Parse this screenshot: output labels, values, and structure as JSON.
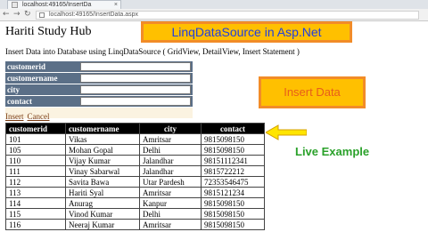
{
  "browser": {
    "tab_title": "localhost:49165/InsertDa",
    "tab_close": "×",
    "back": "←",
    "forward": "→",
    "refresh": "↻",
    "url": "localhost:49165/InsertData.aspx"
  },
  "page": {
    "site_title": "Hariti Study Hub",
    "subtitle": "Insert Data into Database using LinqDataSource ( GridView, DetailView, Insert Statement )"
  },
  "overlays": {
    "banner": "LinqDataSource in Asp.Net",
    "insert_callout": "Insert Data",
    "live_example": "Live Example",
    "colors": {
      "orange_fill": "#ffc000",
      "orange_border": "#f28c28",
      "banner_text": "#1f3fe0",
      "callout_text": "#e85d1a",
      "live_text": "#2aa12a"
    }
  },
  "detailsview": {
    "fields": [
      {
        "label": "customerid",
        "value": ""
      },
      {
        "label": "customername",
        "value": ""
      },
      {
        "label": "city",
        "value": ""
      },
      {
        "label": "contact",
        "value": ""
      }
    ],
    "insert_label": "Insert",
    "cancel_label": "Cancel",
    "colors": {
      "label_bg": "#5b6f87",
      "command_bg": "#fbf3e1"
    }
  },
  "gridview": {
    "columns": [
      "customerid",
      "customername",
      "city",
      "contact"
    ],
    "rows": [
      [
        "101",
        "Vikas",
        "Amritsar",
        "9815098150"
      ],
      [
        "105",
        "Mohan Gopal",
        "Delhi",
        "9815098150"
      ],
      [
        "110",
        "Vijay Kumar",
        "Jalandhar",
        "98151112341"
      ],
      [
        "111",
        "Vinay Sabarwal",
        "Jalandhar",
        "9815722212"
      ],
      [
        "112",
        "Savita Bawa",
        "Utar Pardesh",
        "72353546475"
      ],
      [
        "113",
        "Hariti Syal",
        "Amritsar",
        "9815121234"
      ],
      [
        "114",
        "Anurag",
        "Kanpur",
        "9815098150"
      ],
      [
        "115",
        "Vinod Kumar",
        "Delhi",
        "9815098150"
      ],
      [
        "116",
        "Neeraj Kumar",
        "Amritsar",
        "9815098150"
      ]
    ]
  }
}
